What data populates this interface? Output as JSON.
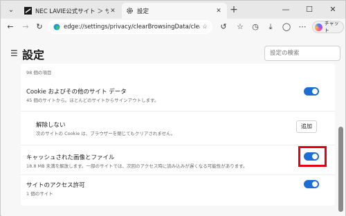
{
  "tabs": [
    {
      "title": "NEC LAVIE公式サイト ＞ サービス＆サポ",
      "close": "✕"
    },
    {
      "title": "設定",
      "close": "✕"
    }
  ],
  "new_tab": "+",
  "window_controls": {
    "minimize": "—",
    "maximize": "☐",
    "close": "✕"
  },
  "address_bar": {
    "url": "edge://settings/privacy/clearBrowsingData/clear..."
  },
  "copilot": {
    "label": "チャット"
  },
  "settings": {
    "page_title": "設定",
    "search_placeholder": "設定の検索",
    "partial_item_sub": "98 個の項目",
    "items": [
      {
        "title": "Cookie およびその他のサイト データ",
        "subtitle": "45 個のサイトから。ほとんどのサイトからサインアウトします。",
        "enabled": true
      },
      {
        "title": "解除しない",
        "subtitle": "次のサイトの Cookie は、ブラウザーを閉じてもクリアされません。",
        "button": "追加"
      },
      {
        "title": "キャッシュされた画像とファイル",
        "subtitle": "18.8 MB 未満を解放します。一部のサイトでは、次回のアクセス時に読み込みが遅くなる可能性があります。",
        "enabled": true
      },
      {
        "title": "サイトのアクセス許可",
        "subtitle": "1 個のサイト",
        "enabled": true
      }
    ]
  },
  "colors": {
    "toggle_on": "#1d6dd7",
    "highlight_box": "#e60012"
  }
}
